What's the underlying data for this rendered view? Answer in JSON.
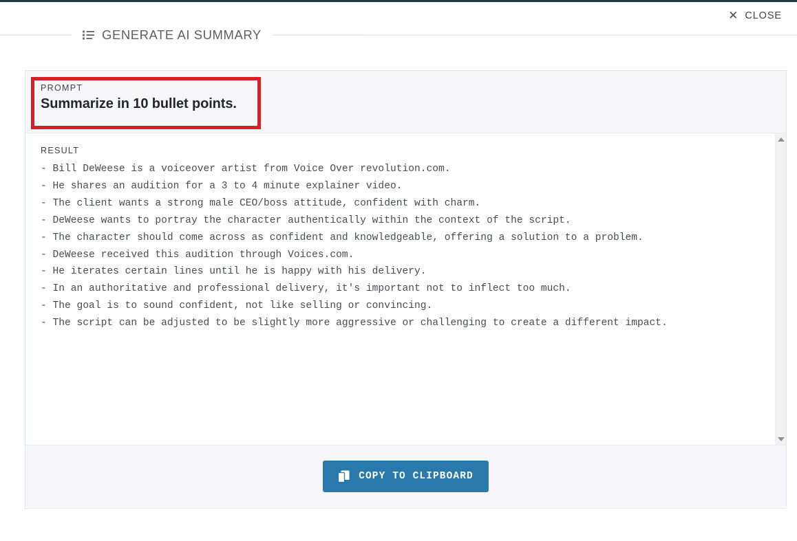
{
  "window": {
    "close_label": "CLOSE",
    "close_icon": "close-x-icon"
  },
  "header": {
    "icon": "bullet-list-icon",
    "title": "GENERATE AI SUMMARY"
  },
  "prompt": {
    "label": "PROMPT",
    "value": "Summarize in 10 bullet points."
  },
  "result": {
    "label": "RESULT",
    "text": "- Bill DeWeese is a voiceover artist from Voice Over revolution.com.\n- He shares an audition for a 3 to 4 minute explainer video.\n- The client wants a strong male CEO/boss attitude, confident with charm.\n- DeWeese wants to portray the character authentically within the context of the script.\n- The character should come across as confident and knowledgeable, offering a solution to a problem.\n- DeWeese received this audition through Voices.com.\n- He iterates certain lines until he is happy with his delivery.\n- In an authoritative and professional delivery, it's important not to inflect too much.\n- The goal is to sound confident, not like selling or convincing.\n- The script can be adjusted to be slightly more aggressive or challenging to create a different impact.",
    "bullets": [
      "Bill DeWeese is a voiceover artist from Voice Over revolution.com.",
      "He shares an audition for a 3 to 4 minute explainer video.",
      "The client wants a strong male CEO/boss attitude, confident with charm.",
      "DeWeese wants to portray the character authentically within the context of the script.",
      "The character should come across as confident and knowledgeable, offering a solution to a problem.",
      "DeWeese received this audition through Voices.com.",
      "He iterates certain lines until he is happy with his delivery.",
      "In an authoritative and professional delivery, it's important not to inflect too much.",
      "The goal is to sound confident, not like selling or convincing.",
      "The script can be adjusted to be slightly more aggressive or challenging to create a different impact."
    ]
  },
  "footer": {
    "copy_label": "COPY TO CLIPBOARD",
    "copy_icon": "copy-pages-icon"
  },
  "scrollbar": {
    "up_icon": "triangle-up-icon",
    "down_icon": "triangle-down-icon"
  },
  "annotation": {
    "type": "highlight-rectangle",
    "color": "#d81f26"
  },
  "colors": {
    "accent_button": "#2a79ad",
    "annotation_red": "#d81f26",
    "panel_border": "#dfe8f0",
    "prompt_bg": "#f7f7fa",
    "footer_bg": "#f6f5f9",
    "top_strip": "#1f3a3d"
  }
}
